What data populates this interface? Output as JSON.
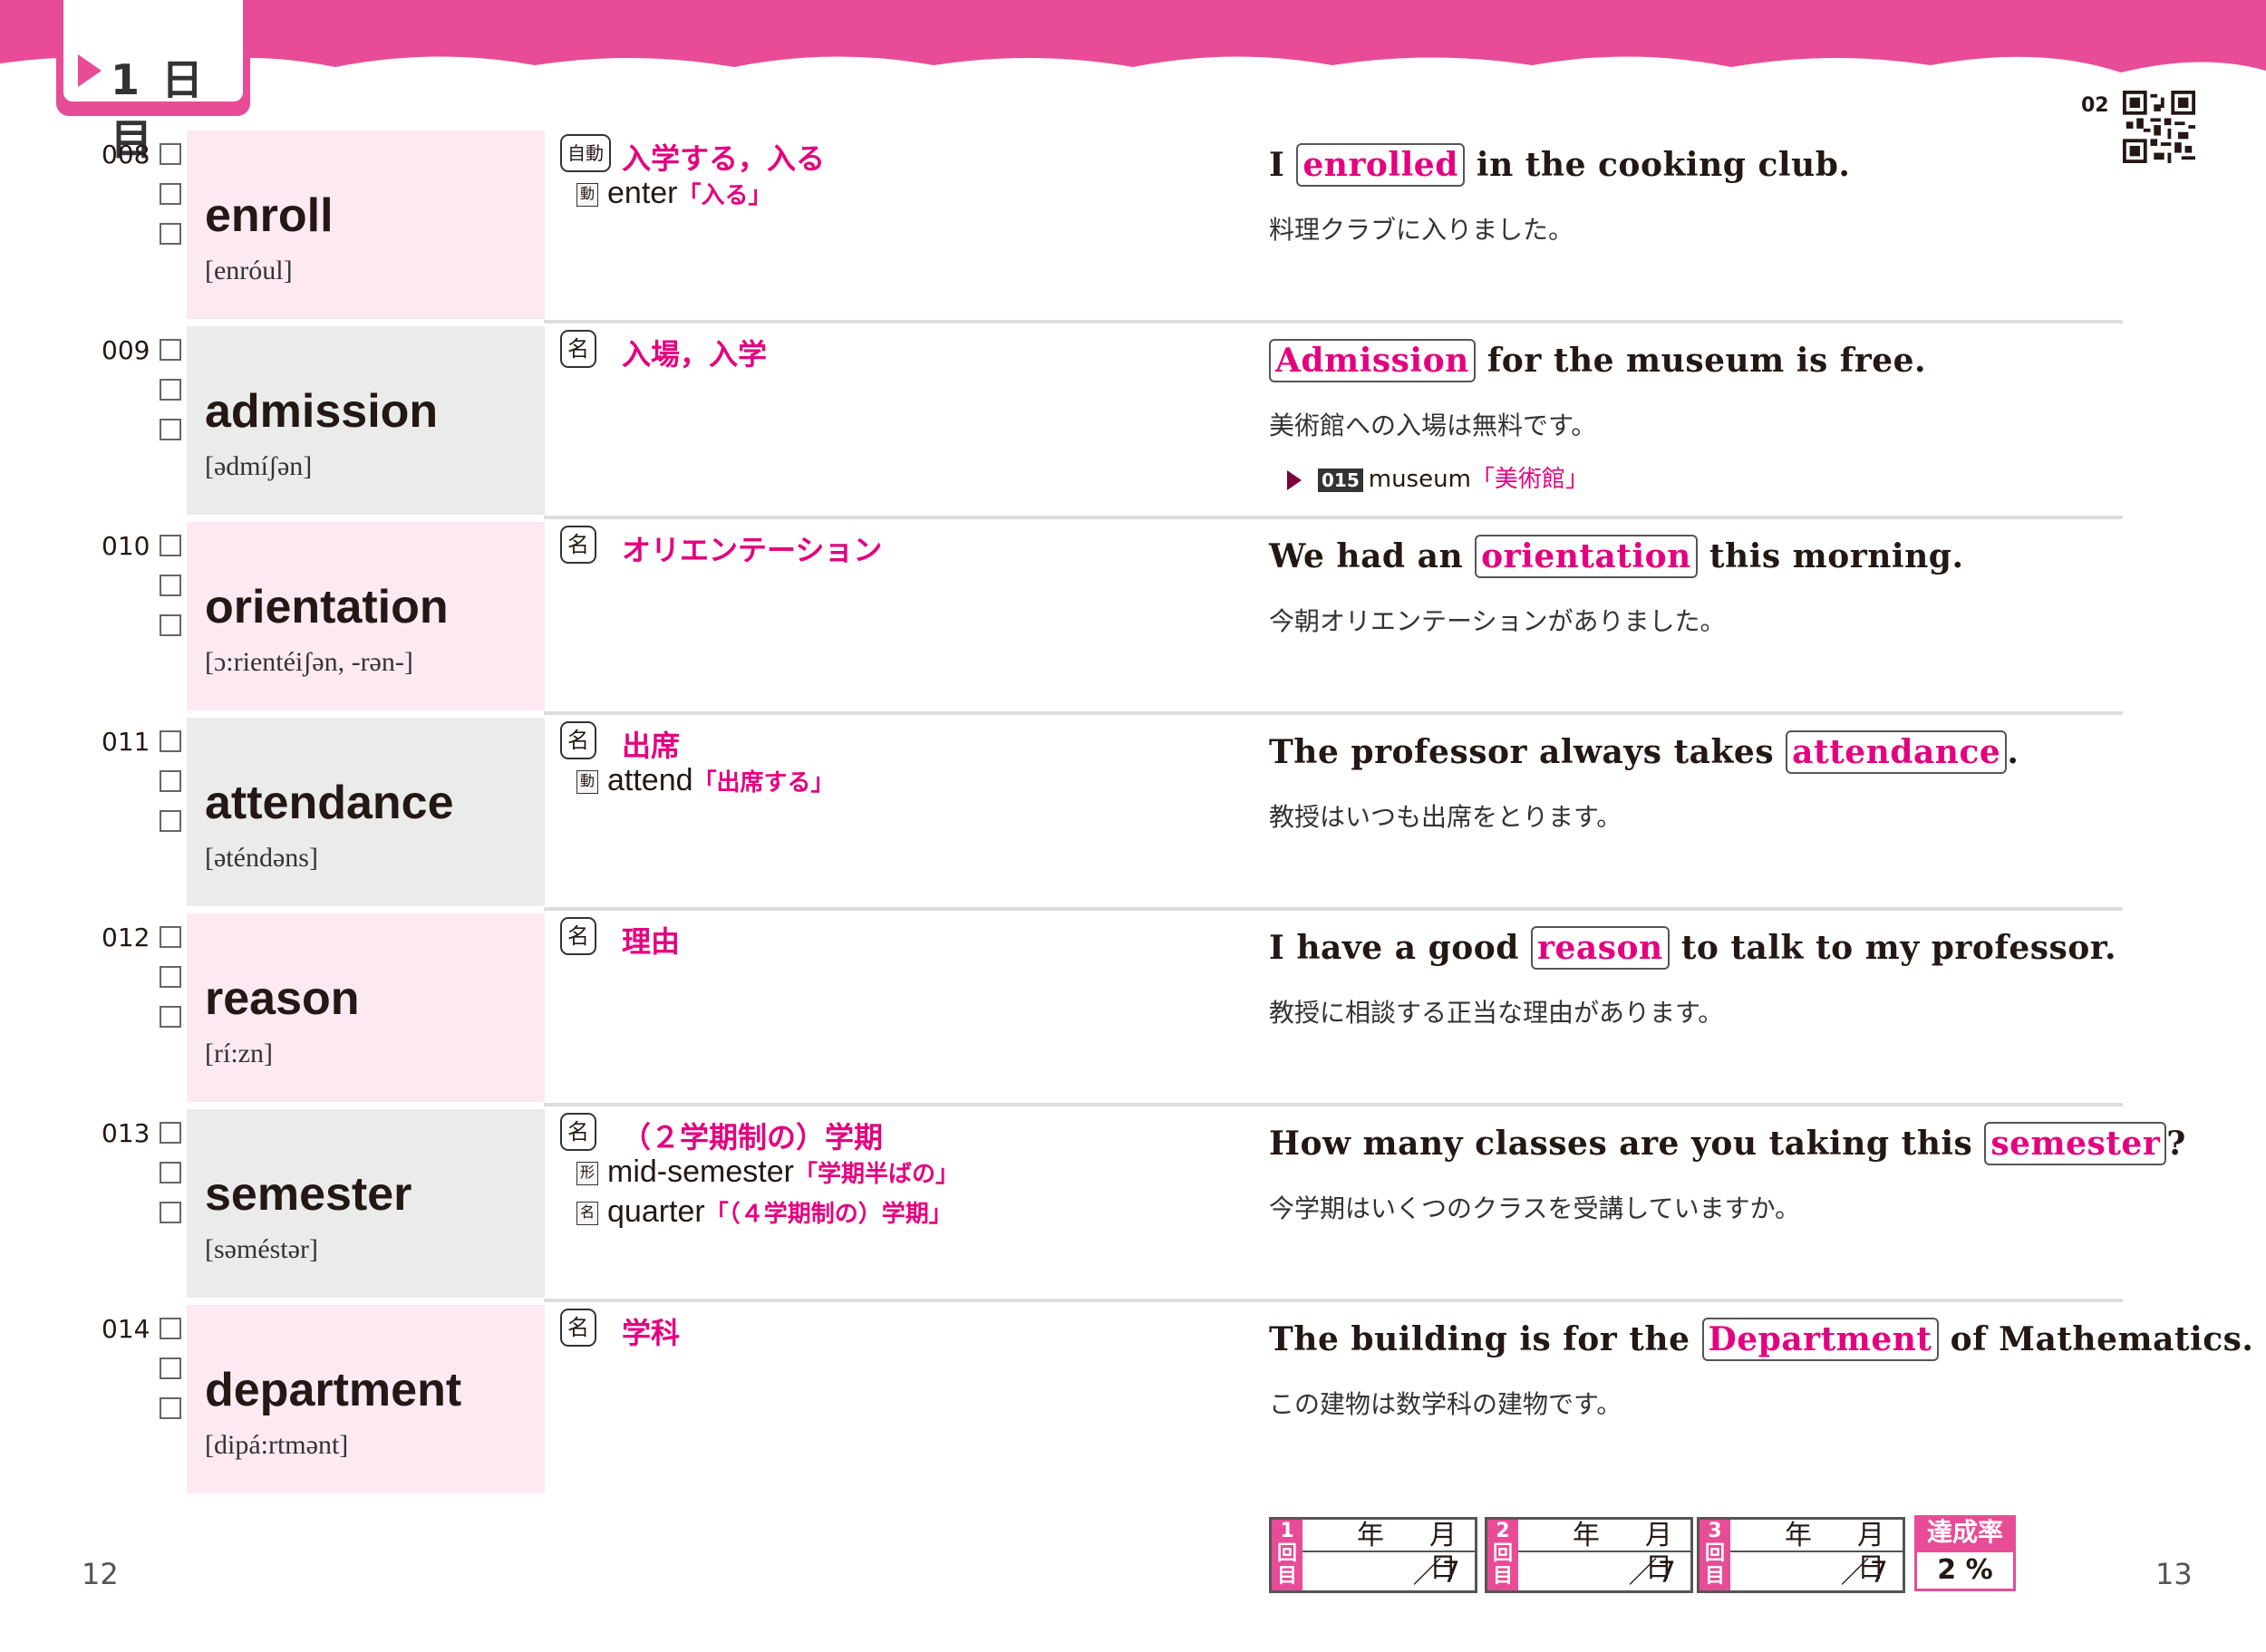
{
  "header": {
    "day_label": "1 日目",
    "track_number": "02"
  },
  "entries": [
    {
      "num": "008",
      "word": "enroll",
      "pron": "[enróul]",
      "pos": "自動",
      "meaning": "入学する，入る",
      "related": [
        {
          "badge": "動",
          "word": "enter",
          "trans": "「入る」"
        }
      ],
      "sentence": {
        "before": "I ",
        "highlight": "enrolled",
        "after": " in the cooking club."
      },
      "translation": "料理クラブに入りました。"
    },
    {
      "num": "009",
      "word": "admission",
      "pron": "[ədmíʃən]",
      "pos": "名",
      "meaning": "入場，入学",
      "related": [],
      "sentence": {
        "before": "",
        "highlight": "Admission",
        "after": " for the museum is free."
      },
      "translation": "美術館への入場は無料です。",
      "note": {
        "num": "015",
        "word": "museum",
        "trans": "「美術館」"
      }
    },
    {
      "num": "010",
      "word": "orientation",
      "pron": "[ɔ:rientéiʃən, -rən-]",
      "pos": "名",
      "meaning": "オリエンテーション",
      "related": [],
      "sentence": {
        "before": "We had an ",
        "highlight": "orientation",
        "after": " this morning."
      },
      "translation": "今朝オリエンテーションがありました。"
    },
    {
      "num": "011",
      "word": "attendance",
      "pron": "[əténdəns]",
      "pos": "名",
      "meaning": "出席",
      "related": [
        {
          "badge": "動",
          "word": "attend",
          "trans": "「出席する」"
        }
      ],
      "sentence": {
        "before": "The professor always takes ",
        "highlight": "attendance",
        "after": "."
      },
      "translation": "教授はいつも出席をとります。"
    },
    {
      "num": "012",
      "word": "reason",
      "pron": "[rí:zn]",
      "pos": "名",
      "meaning": "理由",
      "related": [],
      "sentence": {
        "before": "I have a good ",
        "highlight": "reason",
        "after": " to talk to my professor."
      },
      "translation": "教授に相談する正当な理由があります。"
    },
    {
      "num": "013",
      "word": "semester",
      "pron": "[səméstər]",
      "pos": "名",
      "meaning": "（２学期制の）学期",
      "related": [
        {
          "badge": "形",
          "word": "mid-semester",
          "trans": "「学期半ばの」"
        },
        {
          "badge": "名",
          "word": "quarter",
          "trans": "「（４学期制の）学期」"
        }
      ],
      "sentence": {
        "before": "How many classes are you taking this ",
        "highlight": "semester",
        "after": "?"
      },
      "translation": "今学期はいくつのクラスを受講していますか。"
    },
    {
      "num": "014",
      "word": "department",
      "pron": "[dipá:rtmənt]",
      "pos": "名",
      "meaning": "学科",
      "related": [],
      "sentence": {
        "before": "The building is for the ",
        "highlight": "Department",
        "after": " of Mathematics."
      },
      "translation": "この建物は数学科の建物です。"
    }
  ],
  "footer": {
    "page_left": "12",
    "page_right": "13",
    "records": [
      {
        "side": "1回目",
        "date": "年月日",
        "score": "／7"
      },
      {
        "side": "2回目",
        "date": "年月日",
        "score": "／7"
      },
      {
        "side": "3回目",
        "date": "年月日",
        "score": "／7"
      }
    ],
    "rate_label": "達成率",
    "rate_value": "2 %"
  },
  "colors": {
    "accent": "#e84c97",
    "text_pink": "#e4007f",
    "panel_pink": "#fde9f1",
    "panel_gray": "#ebebeb"
  }
}
